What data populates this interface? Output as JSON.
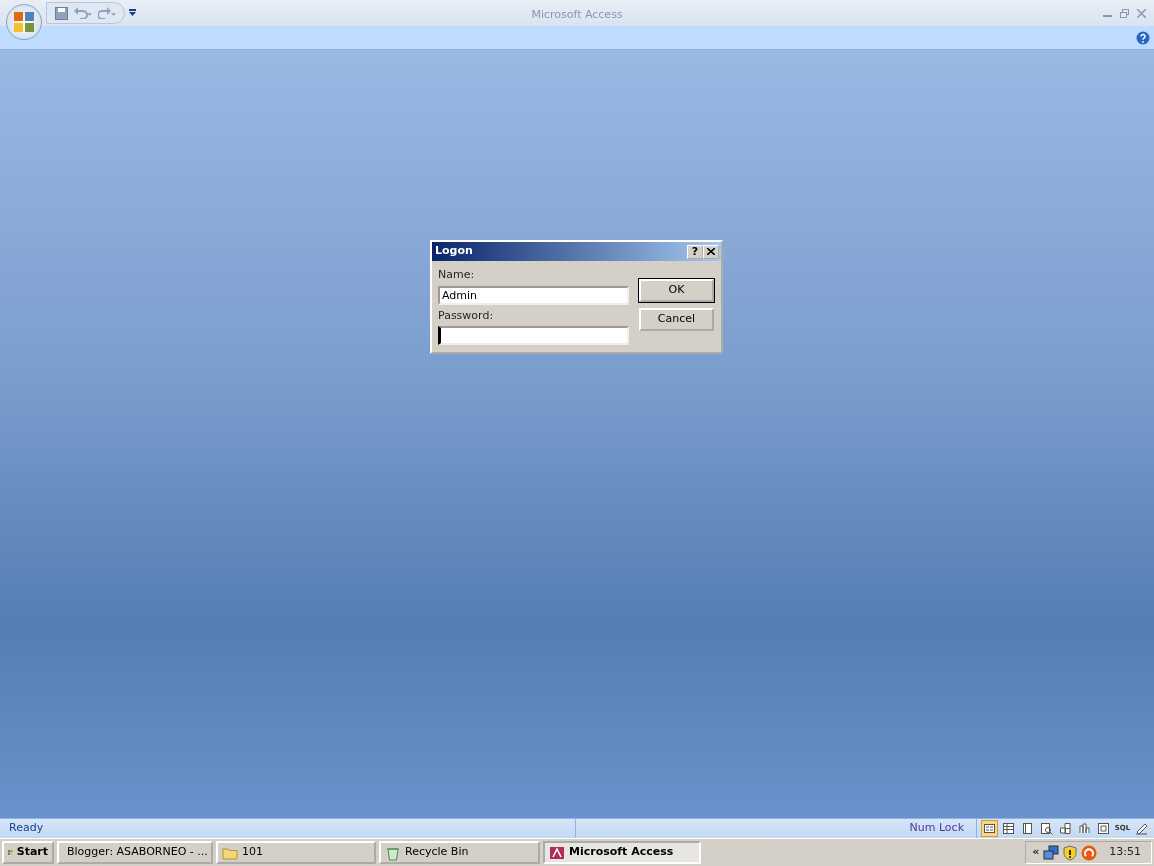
{
  "window": {
    "title": "Microsoft Access"
  },
  "dialog": {
    "title": "Logon",
    "help": "?",
    "fields": [
      {
        "label": "Name:",
        "value": "Admin",
        "focused": false
      },
      {
        "label": "Password:",
        "focused": true
      }
    ],
    "buttons": [
      {
        "label": "OK",
        "default": true
      },
      {
        "label": "Cancel",
        "default": false
      }
    ]
  },
  "status_bar": {
    "message": "Ready",
    "indicator": "Num Lock",
    "view_buttons": [
      {
        "kind": "form",
        "selected": true
      },
      {
        "kind": "datasheet",
        "selected": false
      },
      {
        "kind": "pivot",
        "selected": false
      },
      {
        "kind": "preview",
        "selected": false
      },
      {
        "kind": "grid",
        "selected": false
      },
      {
        "kind": "chart",
        "selected": false
      },
      {
        "kind": "layout",
        "selected": false
      },
      {
        "kind": "sql",
        "label": "SQL",
        "selected": false
      },
      {
        "kind": "design",
        "selected": false
      }
    ]
  },
  "taskbar": {
    "start": "Start",
    "tasks": [
      {
        "kind": "browser",
        "label": "Blogger: ASABORNEO - ...",
        "selected": false
      },
      {
        "kind": "folder",
        "label": "101",
        "selected": false
      },
      {
        "kind": "recycle",
        "label": "Recycle Bin",
        "selected": false
      },
      {
        "kind": "access",
        "label": "Microsoft Access",
        "selected": true
      }
    ],
    "tray": {
      "expand": "«",
      "time": "13:51"
    }
  }
}
